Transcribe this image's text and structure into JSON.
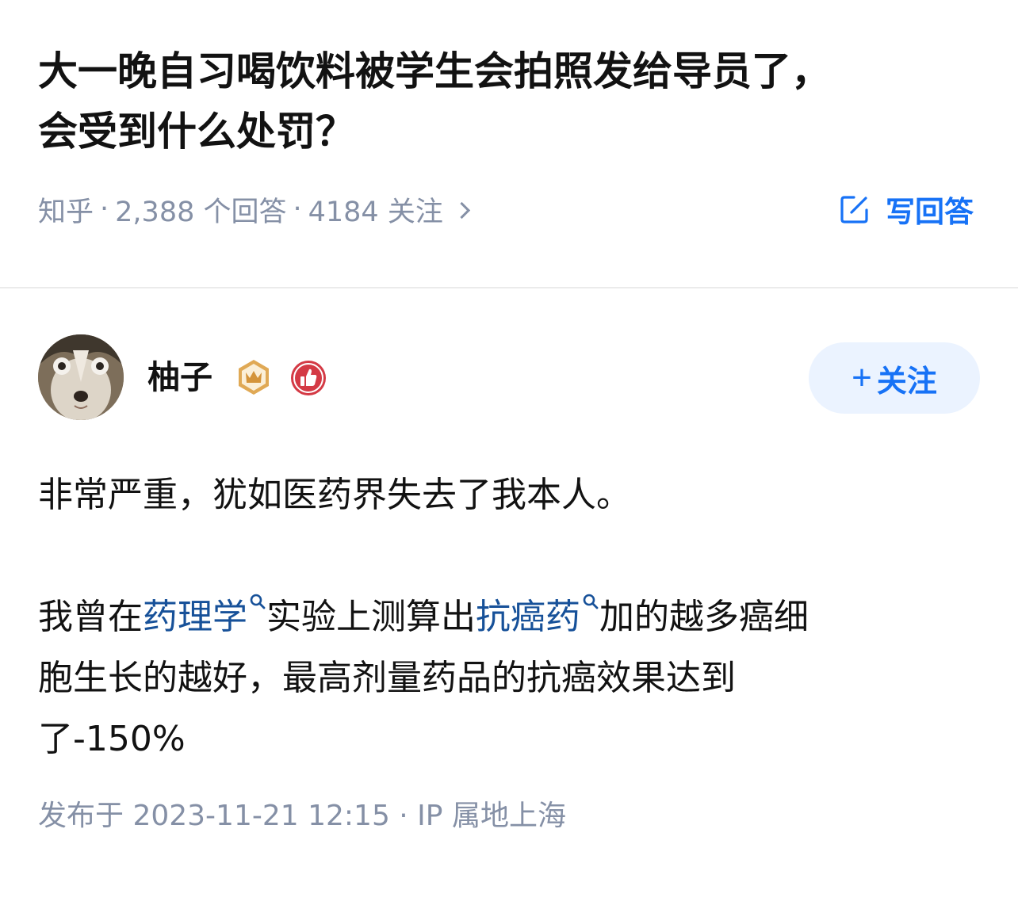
{
  "question": {
    "title_line1": "大一晚自习喝饮料被学生会拍照发给导员了，",
    "title_line2": "会受到什么处罚？",
    "source": "知乎",
    "answers_count": "2,388 个回答",
    "followers_count": "4184 关注",
    "write_answer_label": "写回答"
  },
  "author": {
    "name": "柚子",
    "follow_label": "关注",
    "follow_plus": "+"
  },
  "answer": {
    "para1": "非常严重，犹如医药界失去了我本人。",
    "para2_part1": "我曾在",
    "link1": "药理学",
    "para2_part2": "实验上测算出",
    "link2": "抗癌药",
    "para2_part3": "加的越多癌细",
    "para2_line2": "胞生长的越好，最高剂量药品的抗癌效果达到",
    "para2_line3": "了-150%",
    "publish_info": "发布于 2023-11-21 12:15 · IP 属地上海"
  },
  "icons": {
    "write": "edit-icon",
    "chevron": "chevron-right-icon",
    "search": "search-icon",
    "crown": "crown-badge-icon",
    "like": "thumbs-up-badge-icon"
  },
  "colors": {
    "accent": "#1772f6",
    "link": "#175199",
    "meta": "#8590a6",
    "follow_bg": "#ebf3ff"
  }
}
